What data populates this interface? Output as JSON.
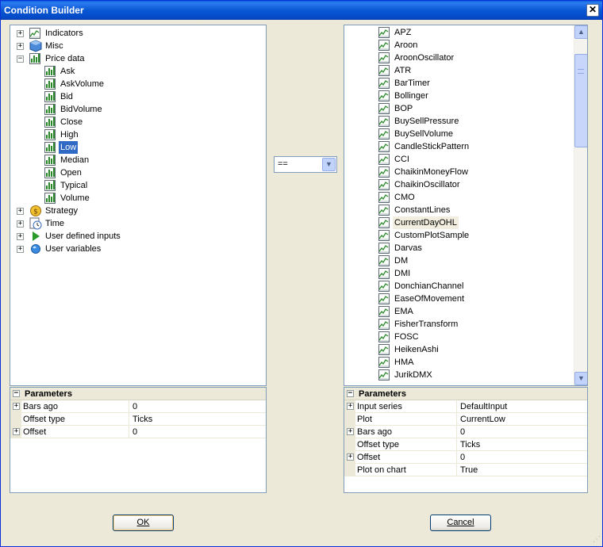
{
  "window": {
    "title": "Condition Builder",
    "close_glyph": "✕"
  },
  "left_tree": [
    {
      "label": "Indicators",
      "level": 0,
      "expander": "+",
      "icon": "line-chart-icon"
    },
    {
      "label": "Misc",
      "level": 0,
      "expander": "+",
      "icon": "cube-icon"
    },
    {
      "label": "Price data",
      "level": 0,
      "expander": "−",
      "icon": "bar-chart-icon"
    },
    {
      "label": "Ask",
      "level": 1,
      "icon": "bar-chart-icon"
    },
    {
      "label": "AskVolume",
      "level": 1,
      "icon": "bar-chart-icon"
    },
    {
      "label": "Bid",
      "level": 1,
      "icon": "bar-chart-icon"
    },
    {
      "label": "BidVolume",
      "level": 1,
      "icon": "bar-chart-icon"
    },
    {
      "label": "Close",
      "level": 1,
      "icon": "bar-chart-icon"
    },
    {
      "label": "High",
      "level": 1,
      "icon": "bar-chart-icon"
    },
    {
      "label": "Low",
      "level": 1,
      "icon": "bar-chart-icon",
      "selected": true
    },
    {
      "label": "Median",
      "level": 1,
      "icon": "bar-chart-icon"
    },
    {
      "label": "Open",
      "level": 1,
      "icon": "bar-chart-icon"
    },
    {
      "label": "Typical",
      "level": 1,
      "icon": "bar-chart-icon"
    },
    {
      "label": "Volume",
      "level": 1,
      "icon": "bar-chart-icon"
    },
    {
      "label": "Strategy",
      "level": 0,
      "expander": "+",
      "icon": "coin-icon"
    },
    {
      "label": "Time",
      "level": 0,
      "expander": "+",
      "icon": "clock-icon"
    },
    {
      "label": "User defined inputs",
      "level": 0,
      "expander": "+",
      "icon": "play-arrow-icon"
    },
    {
      "label": "User variables",
      "level": 0,
      "expander": "+",
      "icon": "globe-icon"
    }
  ],
  "operator": {
    "value": "=="
  },
  "right_list": [
    "APZ",
    "Aroon",
    "AroonOscillator",
    "ATR",
    "BarTimer",
    "Bollinger",
    "BOP",
    "BuySellPressure",
    "BuySellVolume",
    "CandleStickPattern",
    "CCI",
    "ChaikinMoneyFlow",
    "ChaikinOscillator",
    "CMO",
    "ConstantLines",
    "CurrentDayOHL",
    "CustomPlotSample",
    "Darvas",
    "DM",
    "DMI",
    "DonchianChannel",
    "EaseOfMovement",
    "EMA",
    "FisherTransform",
    "FOSC",
    "HeikenAshi",
    "HMA",
    "JurikDMX"
  ],
  "right_list_hover_index": 15,
  "left_params": {
    "header": "Parameters",
    "header_expander": "−",
    "rows": [
      {
        "name": "Bars ago",
        "value": "0",
        "expander": "+"
      },
      {
        "name": "Offset type",
        "value": "Ticks",
        "expander": ""
      },
      {
        "name": "Offset",
        "value": "0",
        "expander": "+"
      }
    ]
  },
  "right_params": {
    "header": "Parameters",
    "header_expander": "−",
    "rows": [
      {
        "name": "Input series",
        "value": "DefaultInput",
        "expander": "+"
      },
      {
        "name": "Plot",
        "value": "CurrentLow",
        "expander": ""
      },
      {
        "name": "Bars ago",
        "value": "0",
        "expander": "+"
      },
      {
        "name": "Offset type",
        "value": "Ticks",
        "expander": ""
      },
      {
        "name": "Offset",
        "value": "0",
        "expander": "+"
      },
      {
        "name": "Plot on chart",
        "value": "True",
        "expander": ""
      }
    ]
  },
  "buttons": {
    "ok": "OK",
    "cancel": "Cancel"
  },
  "colors": {
    "selection": "#316ac5",
    "titlebar": "#0a57d4",
    "bar_icon_green": "#2a8a2a"
  }
}
